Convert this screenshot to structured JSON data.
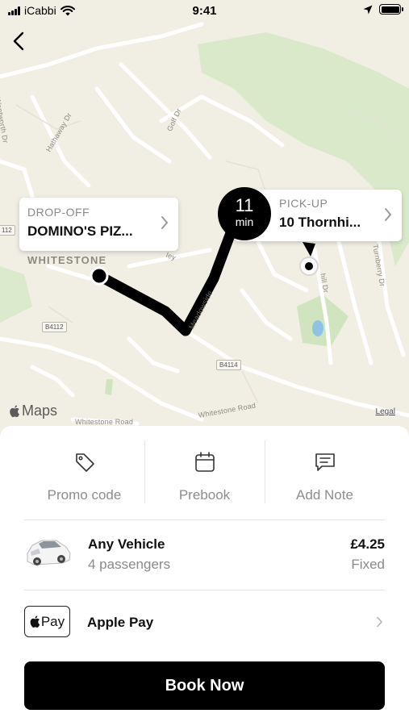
{
  "status_bar": {
    "carrier": "iCabbi",
    "time": "9:41"
  },
  "map": {
    "place_label": "WHITESTONE",
    "street_labels": [
      "Wentworth Dr",
      "Hathaway Dr",
      "Golf Dr",
      "Meadowside",
      "Whitestone Road",
      "Whitestone Road",
      "Turnberry Dr",
      "hill Dr",
      "ley"
    ],
    "road_badges": [
      "B4112",
      "B4114",
      "112"
    ],
    "attribution": "Maps",
    "legal": "Legal",
    "colors": {
      "background": "#f1eee4",
      "green": "#d6e7c7",
      "route": "#000000"
    }
  },
  "route": {
    "dropoff": {
      "title": "DROP-OFF",
      "value": "DOMINO'S PIZ..."
    },
    "pickup": {
      "title": "PICK-UP",
      "value": "10 Thornhi..."
    },
    "eta": {
      "value": "11",
      "unit": "min"
    }
  },
  "actions": [
    {
      "label": "Promo code",
      "icon": "tag-icon"
    },
    {
      "label": "Prebook",
      "icon": "calendar-icon"
    },
    {
      "label": "Add Note",
      "icon": "note-icon"
    }
  ],
  "vehicle": {
    "name": "Any Vehicle",
    "passengers": "4 passengers",
    "price": "£4.25",
    "price_type": "Fixed",
    "icon": "car-icon"
  },
  "payment": {
    "badge": "Pay",
    "method": "Apple Pay",
    "icon": "apple-icon"
  },
  "book_button": "Book Now"
}
